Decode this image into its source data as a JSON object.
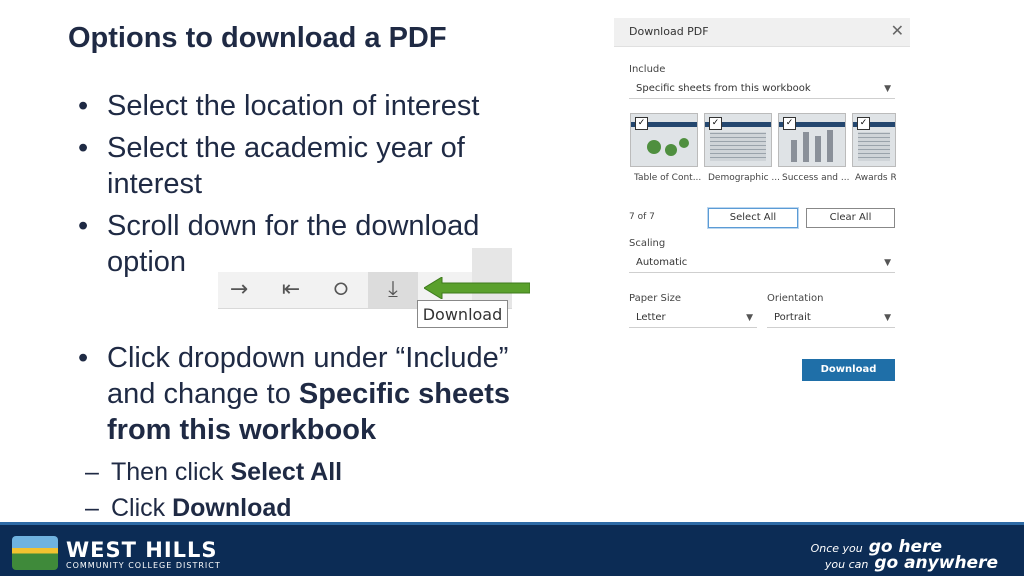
{
  "slide": {
    "title": "Options to download a PDF",
    "bullets": [
      "Select the location of interest",
      "Select the academic year of interest",
      "Scroll down for the download option"
    ],
    "bullet4": {
      "prefix": "Click dropdown under “Include” and change to ",
      "bold": "Specific sheets from this workbook"
    },
    "subs": [
      {
        "prefix": "Then click ",
        "bold": "Select All"
      },
      {
        "prefix": "Click ",
        "bold": "Download"
      }
    ],
    "bullet_glyph": "•",
    "dash_glyph": "–"
  },
  "toolbar": {
    "icons": [
      "arrow-right-icon",
      "skip-to-start-icon",
      "share-icon",
      "download-icon"
    ],
    "glyphs": [
      "→",
      "⇤",
      "⭘",
      "⤓"
    ],
    "tooltip": "Download",
    "arrow_color": "#5aa02c"
  },
  "dialog": {
    "title": "Download PDF",
    "close_glyph": "✕",
    "include_label": "Include",
    "include_value": "Specific sheets from this workbook",
    "sheets": [
      "Table of Cont...",
      "Demographic ...",
      "Success and ...",
      "Awards Re"
    ],
    "count": "7 of 7",
    "select_all": "Select All",
    "clear_all": "Clear All",
    "scaling_label": "Scaling",
    "scaling_value": "Automatic",
    "paper_label": "Paper Size",
    "paper_value": "Letter",
    "orientation_label": "Orientation",
    "orientation_value": "Portrait",
    "download": "Download",
    "caret": "▼",
    "check": "✓",
    "primary_color": "#1f6fa8"
  },
  "footer": {
    "name": "WEST HILLS",
    "subname": "COMMUNITY COLLEGE DISTRICT",
    "tag_line1_a": "Once you",
    "tag_line1_b": "go here",
    "tag_line2_a": "you can",
    "tag_line2_b": "go anywhere",
    "bg_color": "#0c2c55"
  }
}
